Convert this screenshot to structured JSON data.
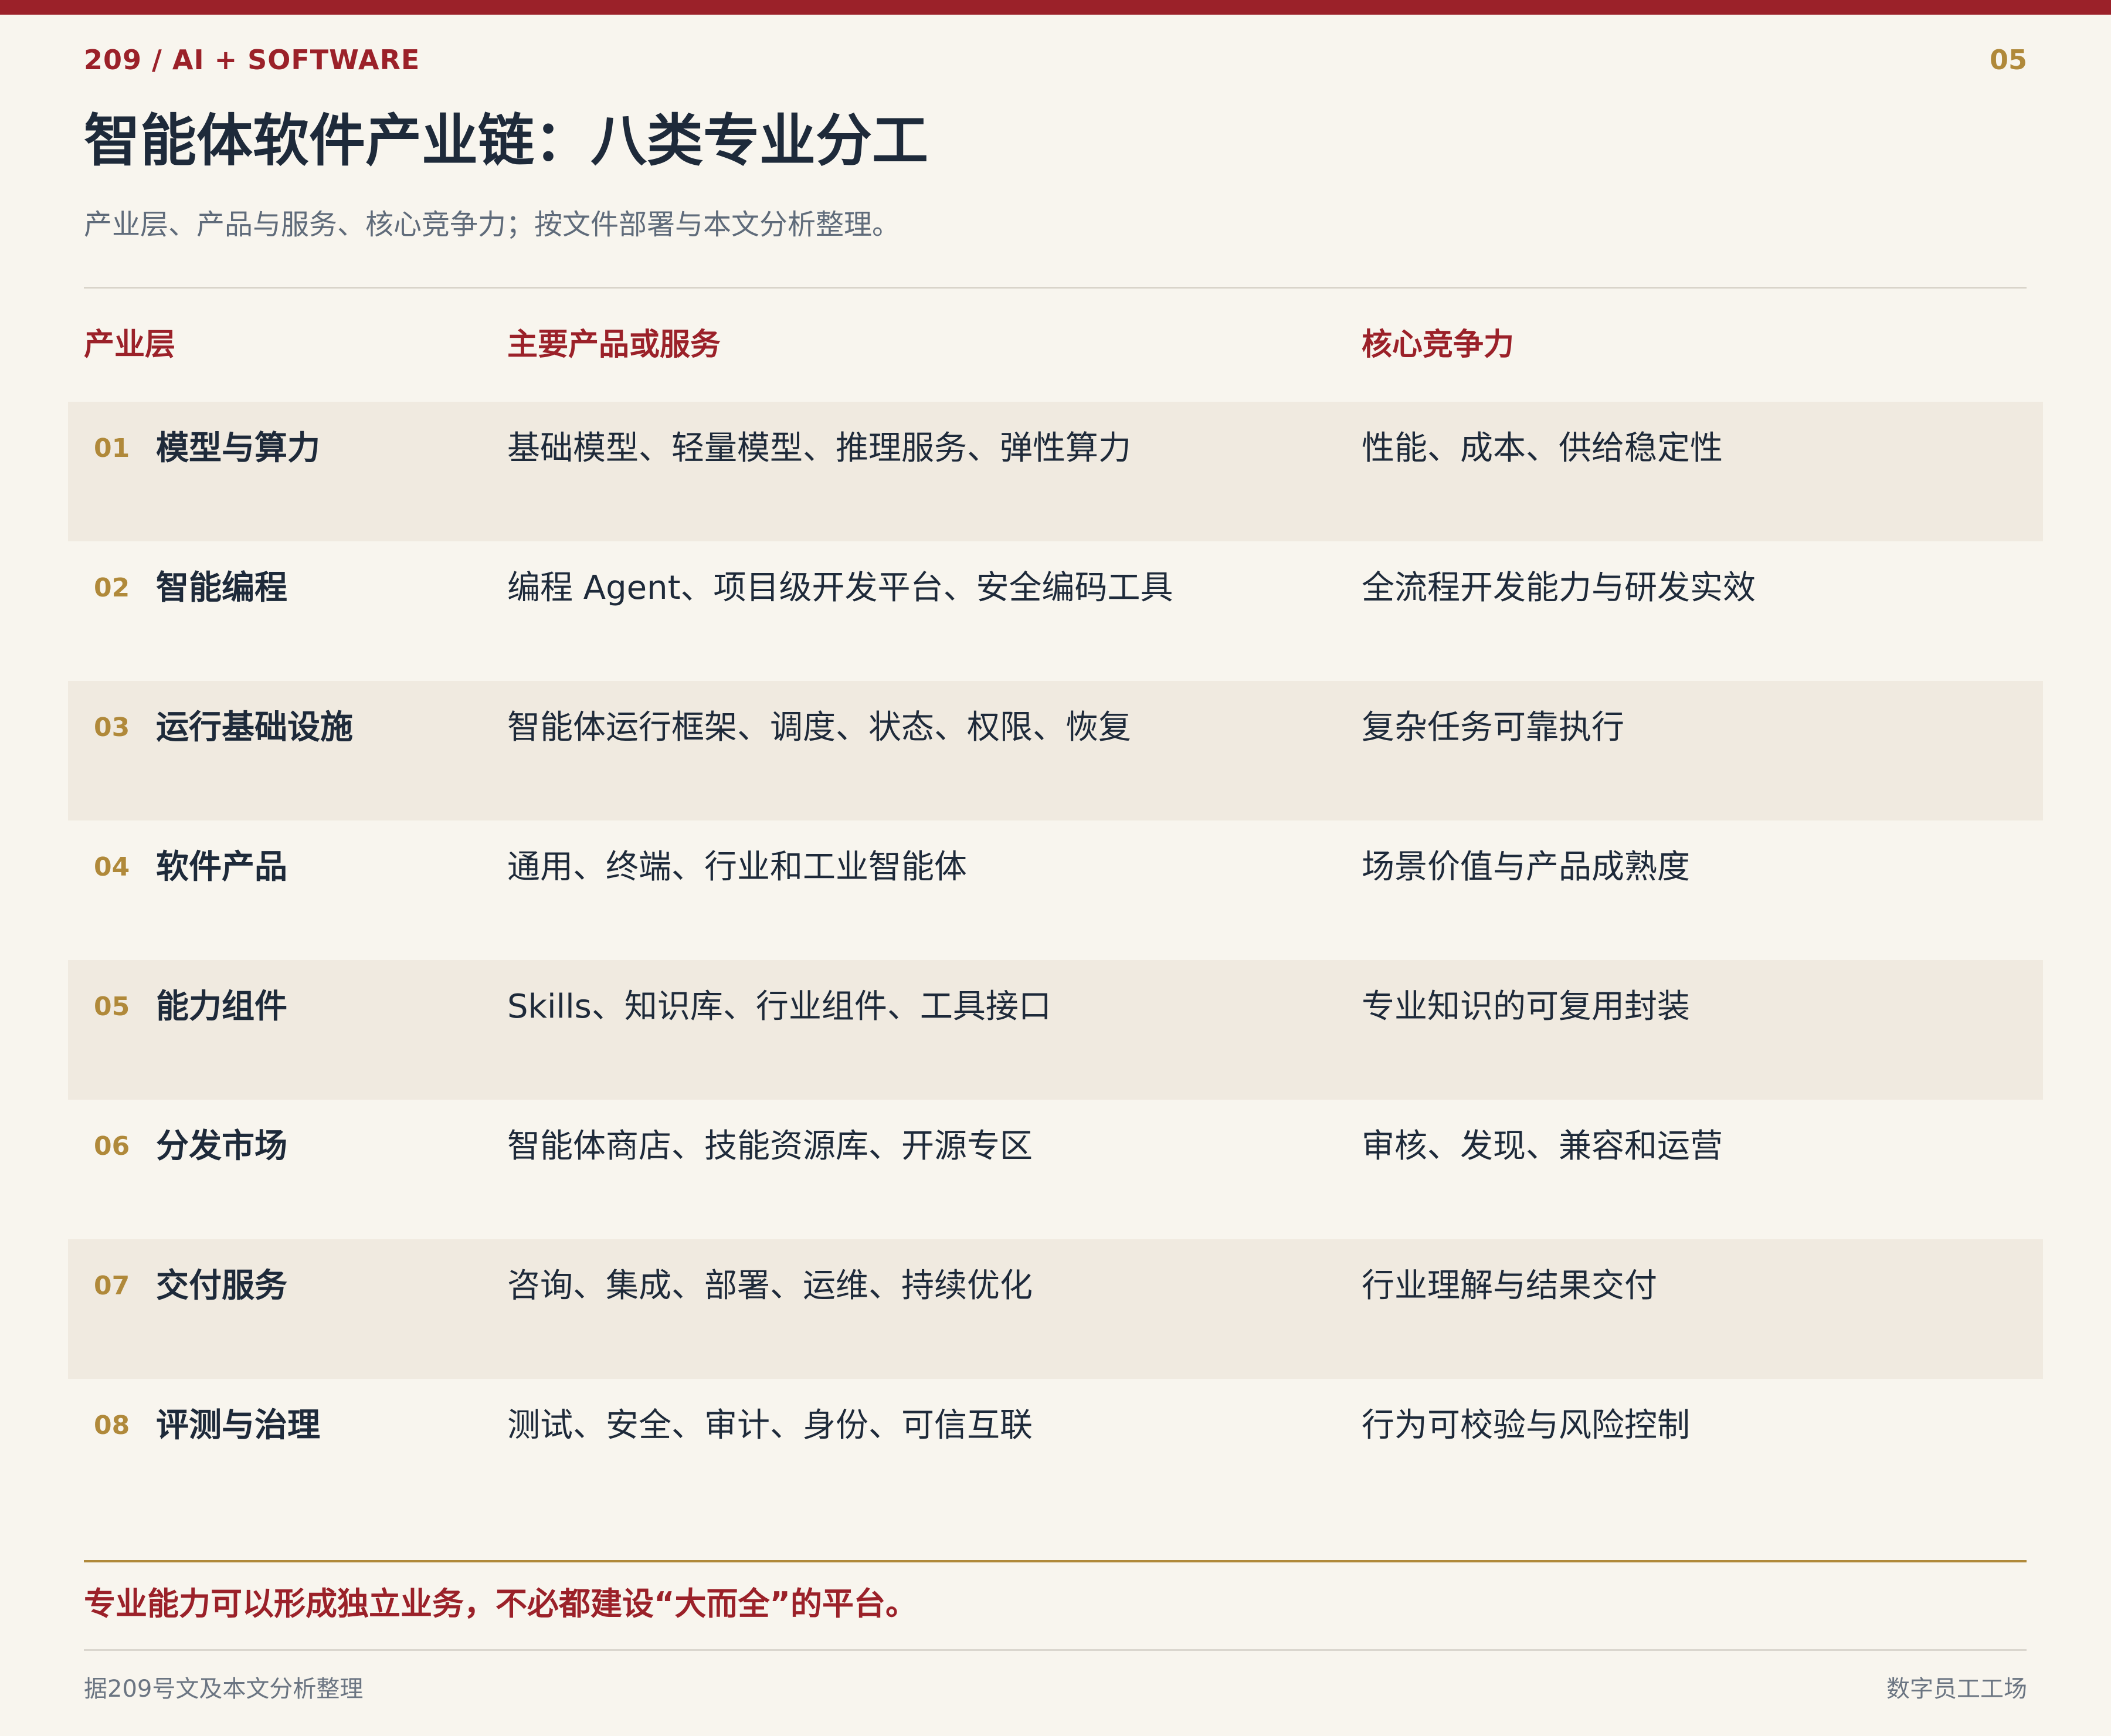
{
  "header": {
    "kicker": "209  /  AI + SOFTWARE",
    "page_number": "05",
    "title": "智能体软件产业链：八类专业分工",
    "subtitle": "产业层、产品与服务、核心竞争力；按文件部署与本文分析整理。"
  },
  "table": {
    "columns": {
      "layer": "产业层",
      "product": "主要产品或服务",
      "core": "核心竞争力"
    },
    "rows": [
      {
        "num": "01",
        "layer": "模型与算力",
        "product": "基础模型、轻量模型、推理服务、弹性算力",
        "core": "性能、成本、供给稳定性"
      },
      {
        "num": "02",
        "layer": "智能编程",
        "product": "编程 Agent、项目级开发平台、安全编码工具",
        "core": "全流程开发能力与研发实效"
      },
      {
        "num": "03",
        "layer": "运行基础设施",
        "product": "智能体运行框架、调度、状态、权限、恢复",
        "core": "复杂任务可靠执行"
      },
      {
        "num": "04",
        "layer": "软件产品",
        "product": "通用、终端、行业和工业智能体",
        "core": "场景价值与产品成熟度"
      },
      {
        "num": "05",
        "layer": "能力组件",
        "product": "Skills、知识库、行业组件、工具接口",
        "core": "专业知识的可复用封装"
      },
      {
        "num": "06",
        "layer": "分发市场",
        "product": "智能体商店、技能资源库、开源专区",
        "core": "审核、发现、兼容和运营"
      },
      {
        "num": "07",
        "layer": "交付服务",
        "product": "咨询、集成、部署、运维、持续优化",
        "core": "行业理解与结果交付"
      },
      {
        "num": "08",
        "layer": "评测与治理",
        "product": "测试、安全、审计、身份、可信互联",
        "core": "行为可校验与风险控制"
      }
    ]
  },
  "conclusion": "专业能力可以形成独立业务，不必都建设“大而全”的平台。",
  "footer": {
    "source": "据209号文及本文分析整理",
    "brand": "数字员工工场"
  },
  "colors": {
    "accent": "#9B2129",
    "gold": "#B0893A",
    "background": "#F8F5EE",
    "row_shade": "#F0EAE0",
    "text": "#1E2A3A"
  }
}
